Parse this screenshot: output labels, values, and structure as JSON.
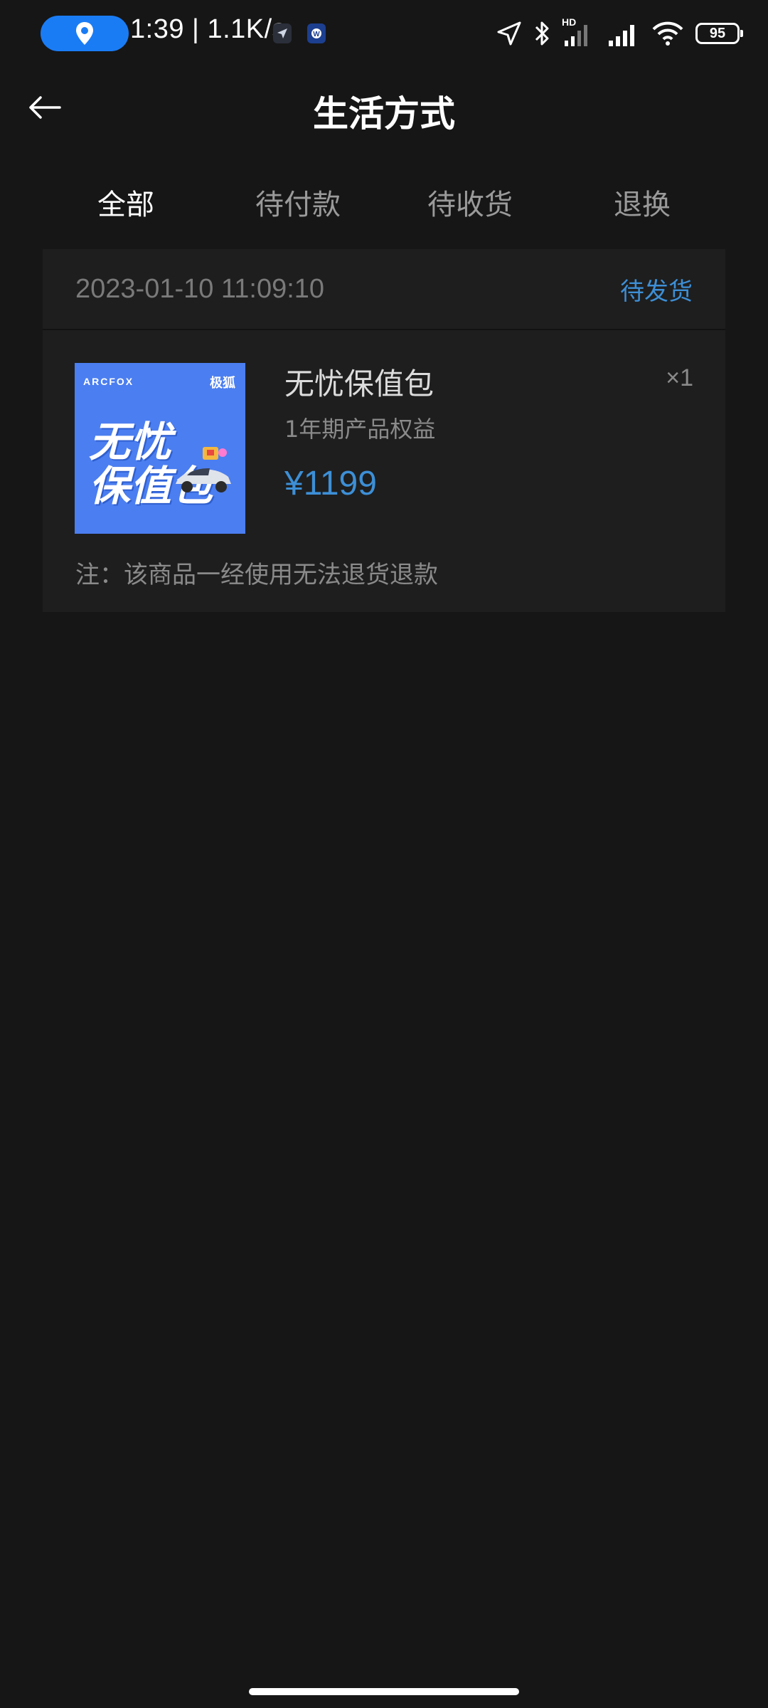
{
  "status_bar": {
    "time_speed": "1:39 | 1.1K/s",
    "battery": "95",
    "network": "HD"
  },
  "header": {
    "title": "生活方式"
  },
  "tabs": [
    {
      "label": "全部",
      "active": true
    },
    {
      "label": "待付款",
      "active": false
    },
    {
      "label": "待收货",
      "active": false
    },
    {
      "label": "退换",
      "active": false
    }
  ],
  "order": {
    "datetime": "2023-01-10 11:09:10",
    "status": "待发货",
    "product": {
      "image": {
        "brand_left": "ARCFOX",
        "brand_right": "极狐",
        "title_line1": "无忧",
        "title_line2": "保值包"
      },
      "name": "无忧保值包",
      "description": "1年期产品权益",
      "quantity": "×1",
      "price": "¥1199"
    },
    "note": "注：该商品一经使用无法退货退款"
  },
  "colors": {
    "background": "#161616",
    "card": "#1e1e1e",
    "accent": "#3d8fd6",
    "location_pill": "#1a7cf5"
  }
}
